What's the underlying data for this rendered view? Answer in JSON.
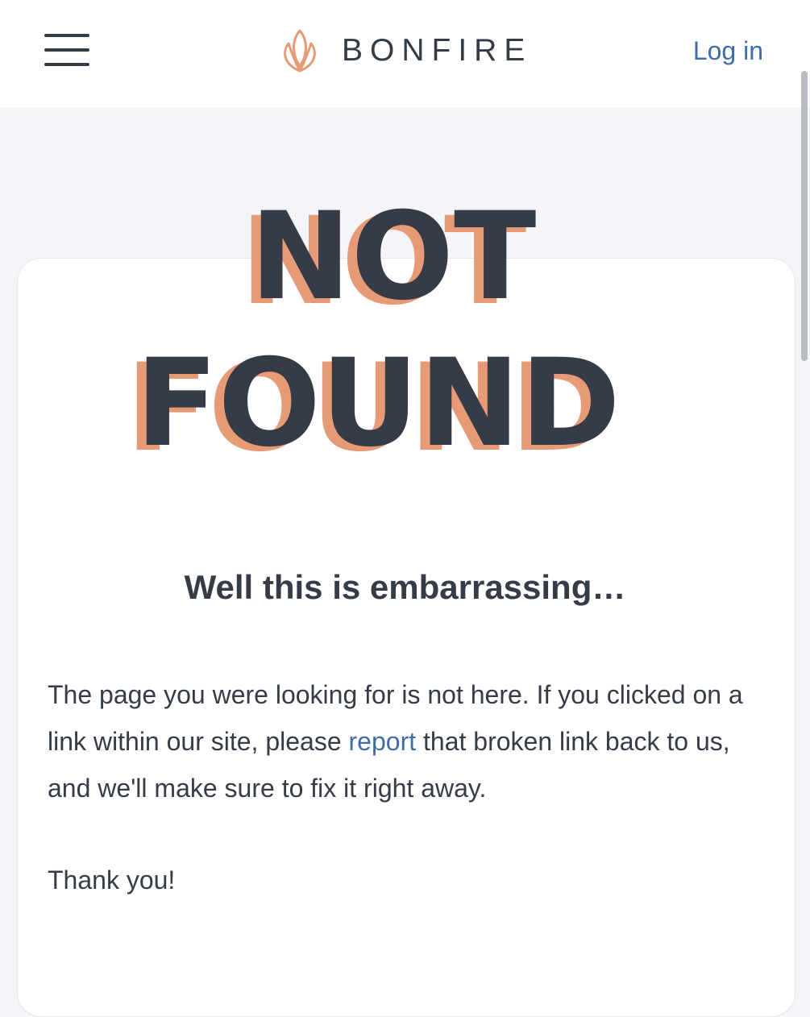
{
  "header": {
    "menu_icon": "hamburger-menu-icon",
    "brand": "BONFIRE",
    "brand_icon": "lotus-flame-icon",
    "login_label": "Log in"
  },
  "hero": {
    "line1": "NOT",
    "line2": "FOUND",
    "colors": {
      "face": "#353c47",
      "shadow": "#e79a76"
    }
  },
  "main": {
    "headline": "Well this is embarrassing…",
    "paragraph_before_link": "The page you were looking for is not here. If you clicked on a link within our site, please ",
    "link_text": "report",
    "paragraph_after_link": " that broken link back to us, and we'll make sure to fix it right away.",
    "thanks": "Thank you!"
  },
  "colors": {
    "accent": "#3f6da6",
    "brand_orange": "#e79a76",
    "text": "#353c47",
    "page_background": "#f4f5f8"
  }
}
